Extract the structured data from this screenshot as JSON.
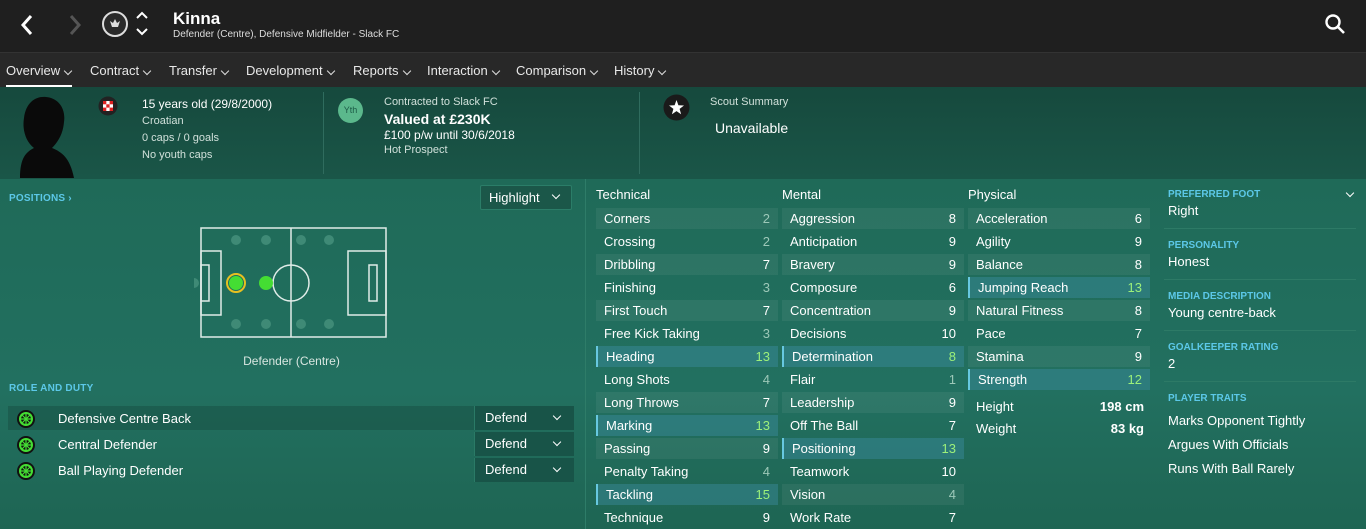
{
  "header": {
    "name": "Kinna",
    "subtitle": "Defender (Centre), Defensive Midfielder - Slack FC"
  },
  "tabs": [
    "Overview",
    "Contract",
    "Transfer",
    "Development",
    "Reports",
    "Interaction",
    "Comparison",
    "History"
  ],
  "info": {
    "age": "15 years old (29/8/2000)",
    "nationality": "Croatian",
    "caps": "0 caps / 0 goals",
    "youth_caps": "No youth caps",
    "yth_badge": "Yth",
    "contracted": "Contracted to Slack FC",
    "valued": "Valued at £230K",
    "wage": "£100 p/w until 30/6/2018",
    "status": "Hot Prospect",
    "scout_label": "Scout Summary",
    "scout_value": "Unavailable"
  },
  "positions": {
    "label": "POSITIONS",
    "highlight": "Highlight",
    "caption": "Defender (Centre)"
  },
  "roles": {
    "label": "ROLE AND DUTY",
    "items": [
      {
        "name": "Defensive Centre Back",
        "duty": "Defend"
      },
      {
        "name": "Central Defender",
        "duty": "Defend"
      },
      {
        "name": "Ball Playing Defender",
        "duty": "Defend"
      }
    ]
  },
  "technical": {
    "title": "Technical",
    "items": [
      {
        "name": "Corners",
        "value": "2"
      },
      {
        "name": "Crossing",
        "value": "2"
      },
      {
        "name": "Dribbling",
        "value": "7"
      },
      {
        "name": "Finishing",
        "value": "3"
      },
      {
        "name": "First Touch",
        "value": "7"
      },
      {
        "name": "Free Kick Taking",
        "value": "3"
      },
      {
        "name": "Heading",
        "value": "13"
      },
      {
        "name": "Long Shots",
        "value": "4"
      },
      {
        "name": "Long Throws",
        "value": "7"
      },
      {
        "name": "Marking",
        "value": "13"
      },
      {
        "name": "Passing",
        "value": "9"
      },
      {
        "name": "Penalty Taking",
        "value": "4"
      },
      {
        "name": "Tackling",
        "value": "15"
      },
      {
        "name": "Technique",
        "value": "9"
      }
    ]
  },
  "mental": {
    "title": "Mental",
    "items": [
      {
        "name": "Aggression",
        "value": "8"
      },
      {
        "name": "Anticipation",
        "value": "9"
      },
      {
        "name": "Bravery",
        "value": "9"
      },
      {
        "name": "Composure",
        "value": "6"
      },
      {
        "name": "Concentration",
        "value": "9"
      },
      {
        "name": "Decisions",
        "value": "10"
      },
      {
        "name": "Determination",
        "value": "8"
      },
      {
        "name": "Flair",
        "value": "1"
      },
      {
        "name": "Leadership",
        "value": "9"
      },
      {
        "name": "Off The Ball",
        "value": "7"
      },
      {
        "name": "Positioning",
        "value": "13"
      },
      {
        "name": "Teamwork",
        "value": "10"
      },
      {
        "name": "Vision",
        "value": "4"
      },
      {
        "name": "Work Rate",
        "value": "7"
      }
    ]
  },
  "physical": {
    "title": "Physical",
    "items": [
      {
        "name": "Acceleration",
        "value": "6"
      },
      {
        "name": "Agility",
        "value": "9"
      },
      {
        "name": "Balance",
        "value": "8"
      },
      {
        "name": "Jumping Reach",
        "value": "13"
      },
      {
        "name": "Natural Fitness",
        "value": "8"
      },
      {
        "name": "Pace",
        "value": "7"
      },
      {
        "name": "Stamina",
        "value": "9"
      },
      {
        "name": "Strength",
        "value": "12"
      }
    ],
    "height_label": "Height",
    "height": "198 cm",
    "weight_label": "Weight",
    "weight": "83 kg"
  },
  "side": {
    "foot_label": "PREFERRED FOOT",
    "foot": "Right",
    "personality_label": "PERSONALITY",
    "personality": "Honest",
    "media_label": "MEDIA DESCRIPTION",
    "media": "Young centre-back",
    "gk_label": "GOALKEEPER RATING",
    "gk": "2",
    "traits_label": "PLAYER TRAITS",
    "traits": [
      "Marks Opponent Tightly",
      "Argues With Officials",
      "Runs With Ball Rarely"
    ]
  }
}
